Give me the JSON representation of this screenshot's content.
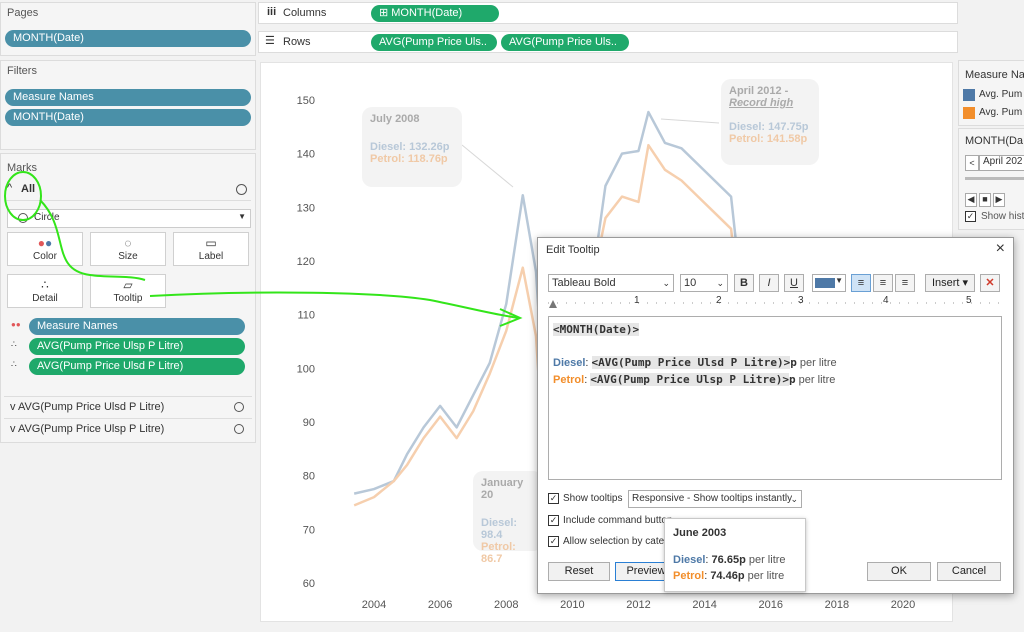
{
  "pages": {
    "title": "Pages",
    "pill": "MONTH(Date)"
  },
  "filters": {
    "title": "Filters",
    "pills": [
      "Measure Names",
      "MONTH(Date)"
    ]
  },
  "marks": {
    "title": "Marks",
    "all_label": "All",
    "mark_type": "Circle",
    "buttons": {
      "color": "Color",
      "size": "Size",
      "label": "Label",
      "detail": "Detail",
      "tooltip": "Tooltip"
    },
    "fields": [
      "Measure Names",
      "AVG(Pump Price Ulsp P Litre)",
      "AVG(Pump Price Ulsd P Litre)"
    ],
    "cards": [
      "AVG(Pump Price Ulsd P Litre)",
      "AVG(Pump Price Ulsp P Litre)"
    ]
  },
  "columns": {
    "label": "Columns",
    "pill": "⊞ MONTH(Date)"
  },
  "rows": {
    "label": "Rows",
    "pills": [
      "AVG(Pump Price Ulsd P Litre)",
      "AVG(Pump Price Ulsp P Litre)"
    ],
    "pills_short": [
      "AVG(Pump Price Uls..",
      "AVG(Pump Price Uls.."
    ]
  },
  "legend": {
    "title": "Measure Na",
    "items": [
      "Avg. Pum",
      "Avg. Pum"
    ],
    "colors": [
      "#4e79a7",
      "#f28e2b"
    ]
  },
  "date_filter": {
    "title": "MONTH(Da",
    "value": "April 202",
    "show_history": "Show hist"
  },
  "chart_data": {
    "type": "line",
    "x": [
      2003.4,
      2004,
      2004.6,
      2005,
      2005.5,
      2006,
      2006.5,
      2007,
      2007.5,
      2008,
      2008.5,
      2008.9,
      2009.1,
      2009.5,
      2010,
      2010.5,
      2011,
      2011.5,
      2012,
      2012.3,
      2012.8,
      2013.3,
      2013.8,
      2014.3,
      2014.8,
      2015.1
    ],
    "series": [
      {
        "name": "Diesel",
        "color": "#b8c8d8",
        "values": [
          76.65,
          77.5,
          79,
          84,
          89,
          93,
          89,
          95,
          101,
          112,
          132.26,
          118,
          98.4,
          99,
          106,
          112,
          134,
          140,
          140.5,
          147.75,
          142,
          141,
          138,
          135,
          132,
          115
        ]
      },
      {
        "name": "Petrol",
        "color": "#f6cfae",
        "values": [
          74.46,
          76,
          79,
          82,
          87,
          91,
          87,
          92,
          99,
          107,
          118.76,
          106,
          86.7,
          93,
          102,
          113,
          128,
          132,
          131,
          141.58,
          137,
          135,
          132,
          129,
          126,
          110
        ]
      }
    ],
    "xticks": [
      "2004",
      "2006",
      "2008",
      "2010",
      "2012",
      "2014",
      "2016",
      "2018",
      "2020"
    ],
    "yticks": [
      "150",
      "140",
      "130",
      "120",
      "110",
      "100",
      "90",
      "80",
      "70",
      "60"
    ],
    "ylim": [
      60,
      150
    ],
    "annotations": {
      "july2008": {
        "title": "July 2008",
        "diesel": "Diesel: 132.26p",
        "petrol": "Petrol: 118.76p"
      },
      "april2012": {
        "title": "April 2012 -",
        "subtitle": "Record high",
        "diesel": "Diesel: 147.75p",
        "petrol": "Petrol: 141.58p"
      },
      "jan2009": {
        "title": "January 20",
        "diesel": "Diesel: 98.4",
        "petrol": "Petrol: 86.7"
      }
    }
  },
  "dialog": {
    "title": "Edit Tooltip",
    "font": "Tableau Bold",
    "size": "10",
    "insert": "Insert",
    "ruler": [
      "1",
      "2",
      "3",
      "4",
      "5"
    ],
    "line1": "<MONTH(Date)>",
    "diesel_label": "Diesel",
    "petrol_label": "Petrol",
    "diesel_field": "<AVG(Pump Price Ulsd P Litre)>",
    "petrol_field": "<AVG(Pump Price Ulsp P Litre)>",
    "p": "p",
    "per_litre": " per litre",
    "colon": ":",
    "show_tooltips": "Show tooltips",
    "tooltip_mode": "Responsive - Show tooltips instantly",
    "include_cmd": "Include command button",
    "allow_sel": "Allow selection by catego",
    "reset": "Reset",
    "preview": "Preview",
    "ok": "OK",
    "cancel": "Cancel"
  },
  "preview_tooltip": {
    "title": "June 2003",
    "diesel_label": "Diesel",
    "diesel_value": "76.65p",
    "petrol_label": "Petrol",
    "petrol_value": "74.46p",
    "per_litre": " per litre"
  },
  "colors": {
    "diesel": "#4e79a7",
    "petrol": "#f28e2b",
    "highlight": "#33e51a",
    "pill_blue": "#4a90a8",
    "pill_green": "#1fa96b"
  }
}
